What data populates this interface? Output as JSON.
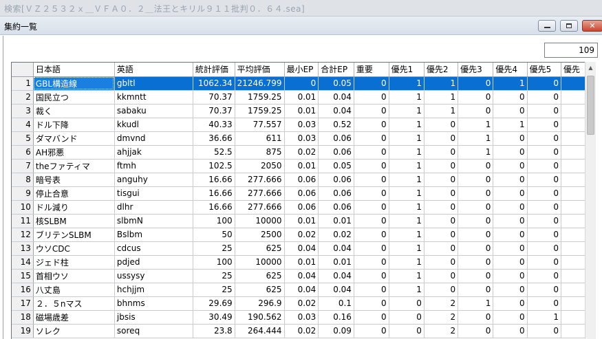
{
  "app": {
    "outer_title": "検索[ＶＺ２５３２ｘ＿ＶＦＡ０．２＿法王とキリル９１１批判０．６４.sea]"
  },
  "window": {
    "title": "集約一覧",
    "min_icon": "minimize-icon",
    "max_icon": "maximize-icon",
    "close_icon": "close-icon",
    "close_glyph": "✕"
  },
  "summary": {
    "count": "109"
  },
  "table": {
    "columns": [
      "日本語",
      "英語",
      "統計評価",
      "平均評価",
      "最小EP",
      "合計EP",
      "重要",
      "優先1",
      "優先2",
      "優先3",
      "優先4",
      "優先5",
      "優先"
    ],
    "selected_row": 1,
    "rows": [
      {
        "n": "1",
        "c": [
          "GBL構造線",
          "gbltl",
          "1062.34",
          "21246.799",
          "0",
          "0.05",
          "0",
          "1",
          "1",
          "0",
          "1",
          "0",
          ""
        ]
      },
      {
        "n": "2",
        "c": [
          "国民立つ",
          "kkmntt",
          "70.37",
          "1759.25",
          "0.01",
          "0.04",
          "0",
          "1",
          "1",
          "0",
          "0",
          "0",
          ""
        ]
      },
      {
        "n": "3",
        "c": [
          "裁く",
          "sabaku",
          "70.37",
          "1759.25",
          "0.01",
          "0.04",
          "0",
          "1",
          "1",
          "0",
          "0",
          "0",
          ""
        ]
      },
      {
        "n": "4",
        "c": [
          "ドル下降",
          "kkudl",
          "40.33",
          "77.557",
          "0.03",
          "0.52",
          "0",
          "1",
          "0",
          "1",
          "1",
          "0",
          ""
        ]
      },
      {
        "n": "5",
        "c": [
          "ダマバンド",
          "dmvnd",
          "36.66",
          "611",
          "0.03",
          "0.06",
          "0",
          "1",
          "0",
          "1",
          "0",
          "0",
          ""
        ]
      },
      {
        "n": "6",
        "c": [
          "AH邪悪",
          "ahjjak",
          "52.5",
          "875",
          "0.02",
          "0.06",
          "0",
          "1",
          "0",
          "1",
          "0",
          "0",
          ""
        ]
      },
      {
        "n": "7",
        "c": [
          "theファティマ",
          "ftmh",
          "102.5",
          "2050",
          "0.01",
          "0.05",
          "0",
          "1",
          "0",
          "0",
          "0",
          "0",
          ""
        ]
      },
      {
        "n": "8",
        "c": [
          "暗号表",
          "anguhy",
          "16.66",
          "277.666",
          "0.06",
          "0.06",
          "0",
          "1",
          "0",
          "0",
          "0",
          "0",
          ""
        ]
      },
      {
        "n": "9",
        "c": [
          "停止合意",
          "tisgui",
          "16.66",
          "277.666",
          "0.06",
          "0.06",
          "0",
          "1",
          "0",
          "0",
          "0",
          "0",
          ""
        ]
      },
      {
        "n": "10",
        "c": [
          "ドル減り",
          "dlhr",
          "16.66",
          "277.666",
          "0.06",
          "0.06",
          "0",
          "1",
          "0",
          "0",
          "0",
          "0",
          ""
        ]
      },
      {
        "n": "11",
        "c": [
          "核SLBM",
          "slbmN",
          "100",
          "10000",
          "0.01",
          "0.01",
          "0",
          "1",
          "0",
          "0",
          "0",
          "0",
          ""
        ]
      },
      {
        "n": "12",
        "c": [
          "ブリテンSLBM",
          "Bslbm",
          "50",
          "2500",
          "0.02",
          "0.02",
          "0",
          "1",
          "0",
          "0",
          "0",
          "0",
          ""
        ]
      },
      {
        "n": "13",
        "c": [
          "ウソCDC",
          "cdcus",
          "25",
          "625",
          "0.04",
          "0.04",
          "0",
          "1",
          "0",
          "0",
          "0",
          "0",
          ""
        ]
      },
      {
        "n": "14",
        "c": [
          "ジェド柱",
          "pdjed",
          "100",
          "10000",
          "0.01",
          "0.01",
          "0",
          "1",
          "0",
          "0",
          "0",
          "0",
          ""
        ]
      },
      {
        "n": "15",
        "c": [
          "首相ウソ",
          "ussysy",
          "25",
          "625",
          "0.04",
          "0.04",
          "0",
          "1",
          "0",
          "0",
          "0",
          "0",
          ""
        ]
      },
      {
        "n": "16",
        "c": [
          "八丈島",
          "hchjjm",
          "25",
          "625",
          "0.04",
          "0.04",
          "0",
          "1",
          "0",
          "0",
          "0",
          "0",
          ""
        ]
      },
      {
        "n": "17",
        "c": [
          "２．５nマス",
          "bhnms",
          "29.69",
          "296.9",
          "0.02",
          "0.1",
          "0",
          "0",
          "2",
          "1",
          "0",
          "0",
          ""
        ]
      },
      {
        "n": "18",
        "c": [
          "磁場歳差",
          "jbsis",
          "30.49",
          "190.562",
          "0.03",
          "0.16",
          "0",
          "0",
          "2",
          "0",
          "0",
          "1",
          ""
        ]
      },
      {
        "n": "19",
        "c": [
          "ソレク",
          "soreq",
          "23.8",
          "264.444",
          "0.02",
          "0.09",
          "0",
          "0",
          "2",
          "0",
          "0",
          "0",
          ""
        ]
      }
    ]
  },
  "scrollbar": {
    "up_icon": "scroll-up-arrow-icon",
    "up_glyph": "▲"
  }
}
